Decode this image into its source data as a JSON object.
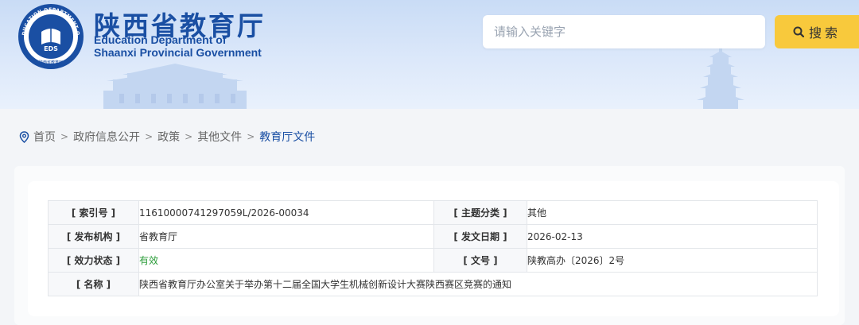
{
  "header": {
    "title_cn": "陕西省教育厅",
    "title_en_line1": "Education Department of",
    "title_en_line2": "Shaanxi Provincial Government",
    "logo": {
      "text_arc": "EDUCATION DEPARTMENT OF SHAANXI",
      "center": "EDS",
      "bottom": "陕西省教育厅"
    }
  },
  "search": {
    "placeholder": "请输入关键字",
    "button_label": "搜索",
    "icon": "search-icon"
  },
  "breadcrumb": {
    "icon": "location-pin-icon",
    "items": [
      "首页",
      "政府信息公开",
      "政策",
      "其他文件",
      "教育厅文件"
    ],
    "separator": ">"
  },
  "info_table": {
    "rows": [
      {
        "label1": "[ 索引号 ]",
        "value1": "11610000741297059L/2026-00034",
        "label2": "[ 主题分类 ]",
        "value2": "其他"
      },
      {
        "label1": "[ 发布机构 ]",
        "value1": "省教育厅",
        "label2": "[ 发文日期 ]",
        "value2": "2026-02-13"
      },
      {
        "label1": "[ 效力状态 ]",
        "value1": "有效",
        "label2": "[ 文号 ]",
        "value2": "陕教高办〔2026〕2号"
      }
    ],
    "name_label": "[ 名称 ]",
    "name_value": "陕西省教育厅办公室关于举办第十二届全国大学生机械创新设计大赛陕西赛区竞赛的通知"
  },
  "colors": {
    "brand_blue": "#1a4fa3",
    "search_yellow": "#f8c93c",
    "status_green": "#2c9d3a"
  }
}
